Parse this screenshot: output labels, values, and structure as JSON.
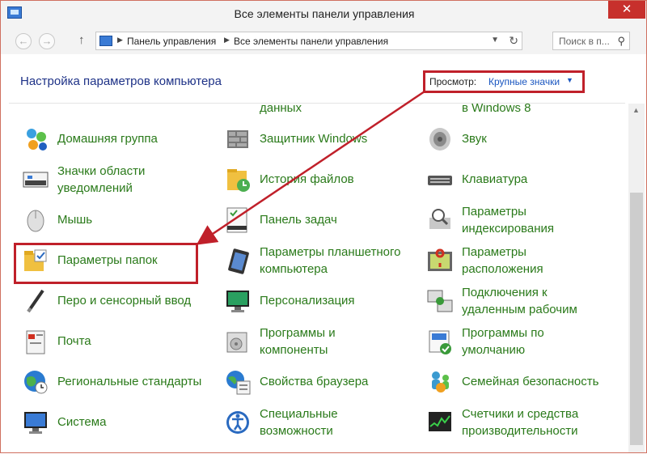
{
  "window": {
    "title": "Все элементы панели управления",
    "close_glyph": "✕"
  },
  "nav": {
    "back_glyph": "←",
    "forward_glyph": "→",
    "up_glyph": "↑",
    "breadcrumbs": [
      "Панель управления",
      "Все элементы панели управления"
    ],
    "crumb_sep": "▶",
    "dropdown_glyph": "▼",
    "refresh_glyph": "↻",
    "search_placeholder": "Поиск в п...",
    "search_glyph": "⚲"
  },
  "content": {
    "title": "Настройка параметров компьютера",
    "view_label": "Просмотр:",
    "view_value": "Крупные значки",
    "view_arrow": "▼"
  },
  "items": [
    {
      "col": 0,
      "row": 0,
      "lines": [
        "Домашняя группа"
      ],
      "icon": "homegroup-icon"
    },
    {
      "col": 1,
      "row": 0,
      "lines": [
        "Защитник Windows"
      ],
      "icon": "defender-icon"
    },
    {
      "col": 2,
      "row": 0,
      "lines": [
        "Звук"
      ],
      "icon": "sound-icon"
    },
    {
      "col": 0,
      "row": 1,
      "lines": [
        "Значки области",
        "уведомлений"
      ],
      "icon": "notification-icons-icon"
    },
    {
      "col": 1,
      "row": 1,
      "lines": [
        "История файлов"
      ],
      "icon": "file-history-icon"
    },
    {
      "col": 2,
      "row": 1,
      "lines": [
        "Клавиатура"
      ],
      "icon": "keyboard-icon"
    },
    {
      "col": 0,
      "row": 2,
      "lines": [
        "Мышь"
      ],
      "icon": "mouse-icon"
    },
    {
      "col": 1,
      "row": 2,
      "lines": [
        "Панель задач"
      ],
      "icon": "taskbar-icon"
    },
    {
      "col": 2,
      "row": 2,
      "lines": [
        "Параметры",
        "индексирования"
      ],
      "icon": "indexing-icon"
    },
    {
      "col": 0,
      "row": 3,
      "lines": [
        "Параметры папок"
      ],
      "icon": "folder-options-icon"
    },
    {
      "col": 1,
      "row": 3,
      "lines": [
        "Параметры планшетного",
        "компьютера"
      ],
      "icon": "tablet-icon"
    },
    {
      "col": 2,
      "row": 3,
      "lines": [
        "Параметры",
        "расположения"
      ],
      "icon": "location-icon"
    },
    {
      "col": 0,
      "row": 4,
      "lines": [
        "Перо и сенсорный ввод"
      ],
      "icon": "pen-icon"
    },
    {
      "col": 1,
      "row": 4,
      "lines": [
        "Персонализация"
      ],
      "icon": "personalization-icon"
    },
    {
      "col": 2,
      "row": 4,
      "lines": [
        "Подключения к",
        "удаленным рабочим"
      ],
      "icon": "remote-desktop-icon"
    },
    {
      "col": 0,
      "row": 5,
      "lines": [
        "Почта"
      ],
      "icon": "mail-icon"
    },
    {
      "col": 1,
      "row": 5,
      "lines": [
        "Программы и",
        "компоненты"
      ],
      "icon": "programs-icon"
    },
    {
      "col": 2,
      "row": 5,
      "lines": [
        "Программы по",
        "умолчанию"
      ],
      "icon": "default-programs-icon"
    },
    {
      "col": 0,
      "row": 6,
      "lines": [
        "Региональные стандарты"
      ],
      "icon": "region-icon"
    },
    {
      "col": 1,
      "row": 6,
      "lines": [
        "Свойства браузера"
      ],
      "icon": "internet-options-icon"
    },
    {
      "col": 2,
      "row": 6,
      "lines": [
        "Семейная безопасность"
      ],
      "icon": "family-safety-icon"
    },
    {
      "col": 0,
      "row": 7,
      "lines": [
        "Система"
      ],
      "icon": "system-icon"
    },
    {
      "col": 1,
      "row": 7,
      "lines": [
        "Специальные",
        "возможности"
      ],
      "icon": "accessibility-icon"
    },
    {
      "col": 2,
      "row": 7,
      "lines": [
        "Счетчики и средства",
        "производительности"
      ],
      "icon": "performance-icon"
    }
  ],
  "partial_row": [
    {
      "col": 1,
      "text": "данных"
    },
    {
      "col": 2,
      "text": "в Windows 8"
    }
  ],
  "colors": {
    "item_text": "#2a7a1a",
    "title": "#1e3287",
    "annotation": "#c0202a",
    "link": "#1a56c0"
  }
}
